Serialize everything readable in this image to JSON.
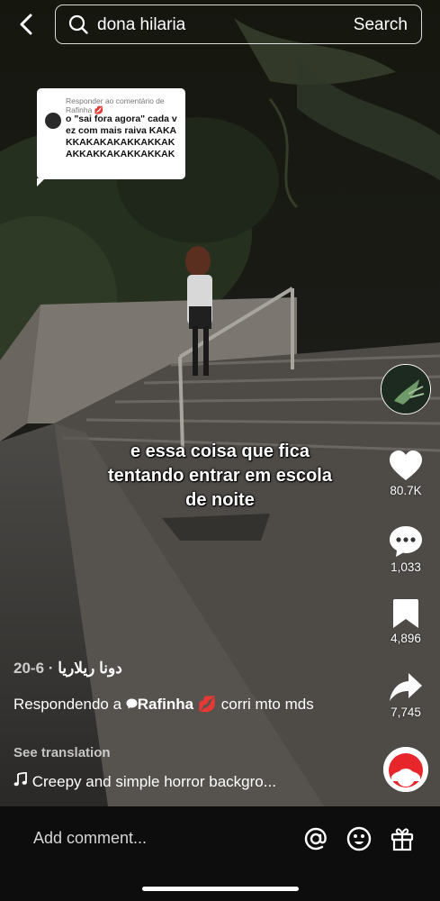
{
  "search": {
    "query": "dona hilaria",
    "button_label": "Search"
  },
  "reply_card": {
    "header": "Responder ao comentário de Rafinha",
    "header_emoji": "💋",
    "comment": "o \"sai fora agora\" cada vez com mais raiva KAKAKKAKAKAKAKKAKKAKAKKAKKAKAKKAKKAK"
  },
  "caption": {
    "line1": "e essa coisa que fica",
    "line2": "tentando entrar em escola",
    "line3": "de noite"
  },
  "actions": {
    "likes": "80.7K",
    "comments": "1,033",
    "saves": "4,896",
    "shares": "7,745"
  },
  "post": {
    "author": "دونا ريلاريا",
    "date": "· 6-20",
    "replying_prefix": "Respondendo a",
    "replying_to": "Rafinha",
    "reply_emoji": "💋",
    "description": "corri mto mds",
    "see_translation": "See translation",
    "music_title": "Creepy and simple horror backgro..."
  },
  "bottom_bar": {
    "comment_placeholder": "Add comment...",
    "icons": [
      "at-icon",
      "emoji-icon",
      "gift-icon"
    ]
  }
}
